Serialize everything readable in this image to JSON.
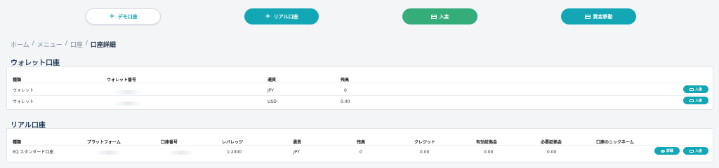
{
  "top_actions": {
    "demo_label": "デモ口座",
    "real_label": "リアル口座",
    "deposit_label": "入金",
    "transfer_label": "資金移動"
  },
  "breadcrumb": {
    "home": "ホーム",
    "sep": "/",
    "menu": "メニュー",
    "account": "口座",
    "current": "口座詳細"
  },
  "wallet": {
    "title": "ウォレット口座",
    "headers": {
      "type": "種類",
      "number": "ウォレット番号",
      "currency": "通貨",
      "balance": "残高"
    },
    "rows": [
      {
        "type": "ウォレット",
        "currency": "JPY",
        "balance": "0",
        "deposit_label": "入金"
      },
      {
        "type": "ウォレット",
        "currency": "USD",
        "balance": "0.00",
        "deposit_label": "入金"
      }
    ]
  },
  "real": {
    "title": "リアル口座",
    "headers": {
      "type": "種類",
      "platform": "プラットフォーム",
      "number": "口座番号",
      "leverage": "レバレッジ",
      "currency": "通貨",
      "balance": "残高",
      "credit": "クレジット",
      "free_margin": "有効証拠金",
      "required_margin": "必要証拠金",
      "nickname": "口座のニックネーム"
    },
    "rows": [
      {
        "type": "EQ スタンダード口座",
        "leverage": "1:2000",
        "currency": "JPY",
        "balance": "0",
        "credit": "0.00",
        "free_margin": "0.00",
        "required_margin": "0.00",
        "detail_label": "詳細",
        "deposit_label": "入金"
      }
    ]
  }
}
